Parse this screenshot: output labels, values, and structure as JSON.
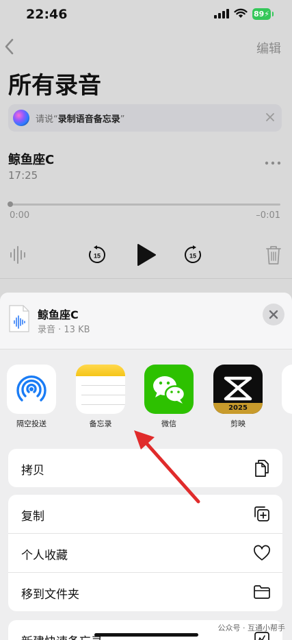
{
  "status_bar": {
    "time": "22:46",
    "battery": "89"
  },
  "nav": {
    "edit_label": "编辑"
  },
  "page_title": "所有录音",
  "siri": {
    "prompt_prefix": "请说“",
    "prompt_phrase": "录制语音备忘录",
    "prompt_suffix": "”"
  },
  "recording": {
    "title": "鲸鱼座C",
    "time": "17:25",
    "elapsed": "0:00",
    "remaining": "–0:01",
    "skip_back_seconds": "15",
    "skip_forward_seconds": "15"
  },
  "share_sheet": {
    "file_name": "鲸鱼座C",
    "file_meta": "录音 · 13 KB",
    "apps": [
      {
        "label": "隔空投送",
        "icon": "airdrop-icon"
      },
      {
        "label": "备忘录",
        "icon": "notes-icon"
      },
      {
        "label": "微信",
        "icon": "wechat-icon"
      },
      {
        "label": "剪映",
        "icon": "capcut-icon",
        "badge": "2025"
      }
    ],
    "actions_group1": [
      {
        "label": "拷贝",
        "icon": "copy-doc-icon"
      }
    ],
    "actions_group2": [
      {
        "label": "复制",
        "icon": "duplicate-icon"
      },
      {
        "label": "个人收藏",
        "icon": "heart-icon"
      },
      {
        "label": "移到文件夹",
        "icon": "folder-icon"
      }
    ],
    "actions_group3": [
      {
        "label": "新建快速备忘录",
        "icon": "quick-note-icon"
      }
    ]
  },
  "watermark": "公众号 · 互通小帮手",
  "colors": {
    "battery": "#34c759",
    "wechat": "#2dc100",
    "notes_accent": "#ffcc00",
    "airdrop": "#1a7cf5",
    "arrow": "#e02b2b"
  }
}
